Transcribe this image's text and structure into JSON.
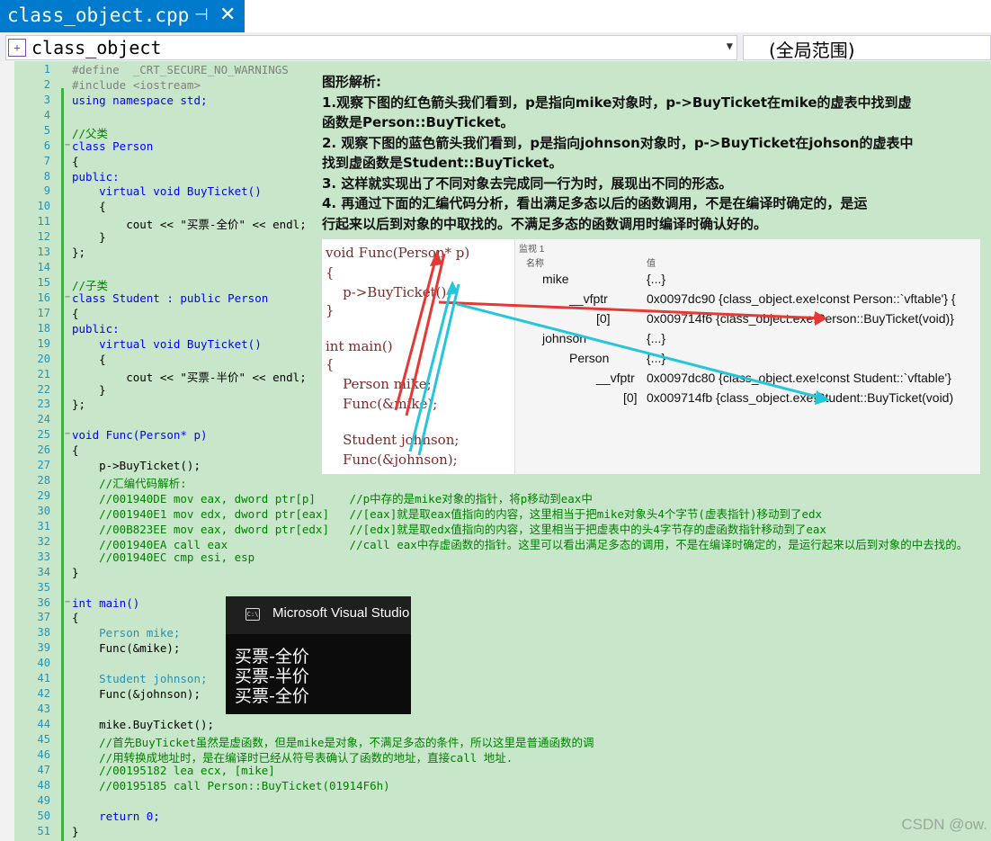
{
  "tab": {
    "title": "class_object.cpp",
    "pin": "⊣",
    "close": "✕"
  },
  "nav": {
    "class_combo": "class_object",
    "scope_combo": "(全局范围)"
  },
  "code_lines": [
    {
      "n": "1",
      "t": "#define  _CRT_SECURE_NO_WARNINGS",
      "k": "pp"
    },
    {
      "n": "2",
      "t": "#include <iostream>",
      "k": "pp"
    },
    {
      "n": "3",
      "t": "using namespace std;",
      "k": "kw"
    },
    {
      "n": "4",
      "t": "",
      "k": ""
    },
    {
      "n": "5",
      "t": "//父类",
      "k": "cm"
    },
    {
      "n": "6",
      "t": "class Person",
      "k": "cls"
    },
    {
      "n": "7",
      "t": "{",
      "k": ""
    },
    {
      "n": "8",
      "t": "public:",
      "k": "kw"
    },
    {
      "n": "9",
      "t": "    virtual void BuyTicket()",
      "k": "kw"
    },
    {
      "n": "10",
      "t": "    {",
      "k": ""
    },
    {
      "n": "11",
      "t": "        cout << \"买票-全价\" << endl;",
      "k": "str"
    },
    {
      "n": "12",
      "t": "    }",
      "k": ""
    },
    {
      "n": "13",
      "t": "};",
      "k": ""
    },
    {
      "n": "14",
      "t": "",
      "k": ""
    },
    {
      "n": "15",
      "t": "//子类",
      "k": "cm"
    },
    {
      "n": "16",
      "t": "class Student : public Person",
      "k": "cls"
    },
    {
      "n": "17",
      "t": "{",
      "k": ""
    },
    {
      "n": "18",
      "t": "public:",
      "k": "kw"
    },
    {
      "n": "19",
      "t": "    virtual void BuyTicket()",
      "k": "kw"
    },
    {
      "n": "20",
      "t": "    {",
      "k": ""
    },
    {
      "n": "21",
      "t": "        cout << \"买票-半价\" << endl;",
      "k": "str"
    },
    {
      "n": "22",
      "t": "    }",
      "k": ""
    },
    {
      "n": "23",
      "t": "};",
      "k": ""
    },
    {
      "n": "24",
      "t": "",
      "k": ""
    },
    {
      "n": "25",
      "t": "void Func(Person* p)",
      "k": "kw"
    },
    {
      "n": "26",
      "t": "{",
      "k": ""
    },
    {
      "n": "27",
      "t": "    p->BuyTicket();",
      "k": ""
    },
    {
      "n": "28",
      "t": "    //汇编代码解析:",
      "k": "cm"
    },
    {
      "n": "29",
      "t": "    //001940DE mov eax, dword ptr[p]     //p中存的是mike对象的指针，将p移动到eax中",
      "k": "cm"
    },
    {
      "n": "30",
      "t": "    //001940E1 mov edx, dword ptr[eax]   //[eax]就是取eax值指向的内容，这里相当于把mike对象头4个字节(虚表指针)移动到了edx",
      "k": "cm"
    },
    {
      "n": "31",
      "t": "    //00B823EE mov eax, dword ptr[edx]   //[edx]就是取edx值指向的内容，这里相当于把虚表中的头4字节存的虚函数指针移动到了eax",
      "k": "cm"
    },
    {
      "n": "32",
      "t": "    //001940EA call eax                  //call eax中存虚函数的指针。这里可以看出满足多态的调用，不是在编译时确定的，是运行起来以后到对象的中去找的。",
      "k": "cm"
    },
    {
      "n": "33",
      "t": "    //001940EC cmp esi, esp",
      "k": "cm"
    },
    {
      "n": "34",
      "t": "}",
      "k": ""
    },
    {
      "n": "35",
      "t": "",
      "k": ""
    },
    {
      "n": "36",
      "t": "int main()",
      "k": "kw"
    },
    {
      "n": "37",
      "t": "{",
      "k": ""
    },
    {
      "n": "38",
      "t": "    Person mike;",
      "k": "ty"
    },
    {
      "n": "39",
      "t": "    Func(&mike);",
      "k": ""
    },
    {
      "n": "40",
      "t": "",
      "k": ""
    },
    {
      "n": "41",
      "t": "    Student johnson;",
      "k": "ty"
    },
    {
      "n": "42",
      "t": "    Func(&johnson);",
      "k": ""
    },
    {
      "n": "43",
      "t": "",
      "k": ""
    },
    {
      "n": "44",
      "t": "    mike.BuyTicket();",
      "k": ""
    },
    {
      "n": "45",
      "t": "    //首先BuyTicket虽然是虚函数，但是mike是对象，不满足多态的条件，所以这里是普通函数的调",
      "k": "cm"
    },
    {
      "n": "46",
      "t": "    //用转换成地址时，是在编译时已经从符号表确认了函数的地址，直接call 地址.",
      "k": "cm"
    },
    {
      "n": "47",
      "t": "    //00195182 lea ecx, [mike]",
      "k": "cm"
    },
    {
      "n": "48",
      "t": "    //00195185 call Person::BuyTicket(01914F6h)",
      "k": "cm"
    },
    {
      "n": "49",
      "t": "",
      "k": ""
    },
    {
      "n": "50",
      "t": "    return 0;",
      "k": "kw"
    },
    {
      "n": "51",
      "t": "}",
      "k": ""
    }
  ],
  "analysis": [
    "图形解析:",
    "1.观察下图的红色箭头我们看到，p是指向mike对象时，p->BuyTicket在mike的虚表中找到虚",
    "函数是Person::BuyTicket。",
    "2. 观察下图的蓝色箭头我们看到，p是指向johnson对象时，p->BuyTicket在johson的虚表中",
    "找到虚函数是Student::BuyTicket。",
    "3. 这样就实现出了不同对象去完成同一行为时，展现出不同的形态。",
    "4. 再通过下面的汇编代码分析，看出满足多态以后的函数调用，不是在编译时确定的，是运",
    "行起来以后到对象的中取找的。不满足多态的函数调用时编译时确认好的。"
  ],
  "figure": {
    "code": [
      "void Func(Person* p)",
      "{",
      "    p->BuyTicket();",
      "}",
      "int main()",
      "{",
      "    Person mike;",
      "    Func(&mike);",
      "    Student johnson;",
      "    Func(&johnson);"
    ],
    "watch_title": "监视 1",
    "watch_header": [
      "名称",
      "值"
    ],
    "watch_rows": [
      {
        "name": "mike",
        "value": "{...}"
      },
      {
        "name": "__vfptr",
        "value": "0x0097dc90 {class_object.exe!const Person::`vftable'} {"
      },
      {
        "name": "[0]",
        "value": "0x009714f6 {class_object.exe!Person::BuyTicket(void)}"
      },
      {
        "name": "johnson",
        "value": "{...}"
      },
      {
        "name": "Person",
        "value": "{...}"
      },
      {
        "name": "__vfptr",
        "value": "0x0097dc80 {class_object.exe!const Student::`vftable'}"
      },
      {
        "name": "[0]",
        "value": "0x009714fb {class_object.exe!Student::BuyTicket(void)"
      }
    ]
  },
  "console": {
    "title": "Microsoft Visual Studio",
    "lines": [
      "买票-全价",
      "买票-半价",
      "买票-全价"
    ]
  },
  "watermark": "CSDN @ow.",
  "colors": {
    "accent": "#007acc",
    "editor_bg": "#c8e6c9",
    "red_arrow": "#e53935",
    "blue_arrow": "#26c6da"
  }
}
